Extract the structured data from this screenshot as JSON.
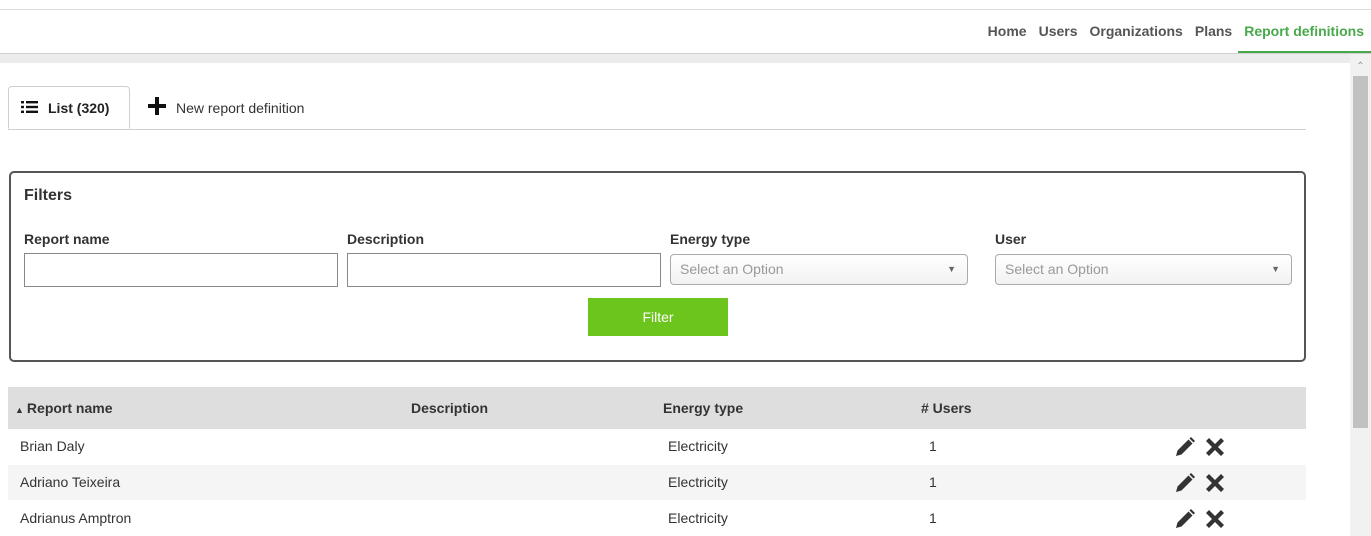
{
  "nav": {
    "items": [
      {
        "label": "Home"
      },
      {
        "label": "Users"
      },
      {
        "label": "Organizations"
      },
      {
        "label": "Plans"
      },
      {
        "label": "Report definitions",
        "active": true
      }
    ]
  },
  "tabs": {
    "list_label": "List (320)",
    "new_label": "New report definition"
  },
  "filters": {
    "title": "Filters",
    "report_name_label": "Report name",
    "report_name_value": "",
    "description_label": "Description",
    "description_value": "",
    "energy_type_label": "Energy type",
    "energy_type_placeholder": "Select an Option",
    "user_label": "User",
    "user_placeholder": "Select an Option",
    "filter_button": "Filter"
  },
  "table": {
    "columns": {
      "sort_indicator": "▲",
      "report_name": "Report name",
      "description": "Description",
      "energy_type": "Energy type",
      "users": "# Users"
    },
    "rows": [
      {
        "report_name": "Brian Daly",
        "description": "",
        "energy_type": "Electricity",
        "users": "1"
      },
      {
        "report_name": "Adriano Teixeira",
        "description": "",
        "energy_type": "Electricity",
        "users": "1"
      },
      {
        "report_name": "Adrianus Amptron",
        "description": "",
        "energy_type": "Electricity",
        "users": "1"
      }
    ]
  },
  "colors": {
    "accent": "#49a84b",
    "filter_button": "#6cc51c"
  },
  "icons": {
    "list_tab": "list-icon",
    "new_tab": "plus-icon",
    "edit": "pencil-icon",
    "delete": "close-icon"
  }
}
